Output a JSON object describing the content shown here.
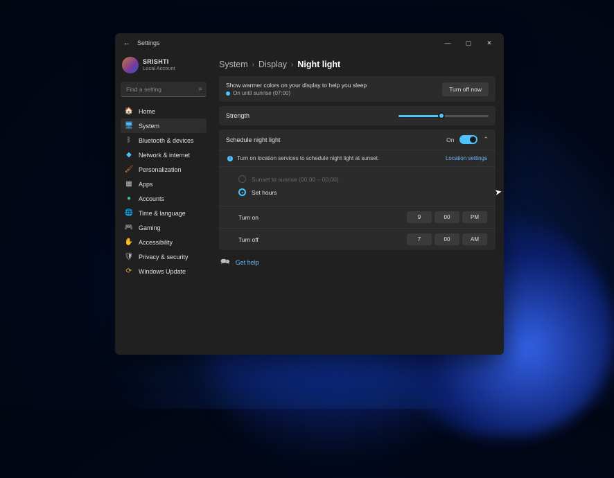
{
  "window": {
    "title": "Settings"
  },
  "user": {
    "name": "SRISHTI",
    "sub": "Local Account"
  },
  "search": {
    "placeholder": "Find a setting"
  },
  "nav": {
    "items": [
      {
        "icon": "🏠",
        "label": "Home",
        "cls": "i-gray"
      },
      {
        "icon": "🖥",
        "label": "System",
        "cls": "i-blue",
        "active": true
      },
      {
        "icon": "ᛒ",
        "label": "Bluetooth & devices",
        "cls": "i-gray"
      },
      {
        "icon": "◆",
        "label": "Network & internet",
        "cls": "i-blue"
      },
      {
        "icon": "🖌",
        "label": "Personalization",
        "cls": "i-orange"
      },
      {
        "icon": "▦",
        "label": "Apps",
        "cls": "i-gray"
      },
      {
        "icon": "●",
        "label": "Accounts",
        "cls": "i-teal"
      },
      {
        "icon": "🌐",
        "label": "Time & language",
        "cls": "i-gray"
      },
      {
        "icon": "🎮",
        "label": "Gaming",
        "cls": "i-gray"
      },
      {
        "icon": "✋",
        "label": "Accessibility",
        "cls": "i-blue"
      },
      {
        "icon": "🛡",
        "label": "Privacy & security",
        "cls": "i-gray"
      },
      {
        "icon": "⟳",
        "label": "Windows Update",
        "cls": "i-yellow"
      }
    ]
  },
  "breadcrumb": {
    "a": "System",
    "b": "Display",
    "c": "Night light"
  },
  "top": {
    "line1": "Show warmer colors on your display to help you sleep",
    "line2": "On until sunrise (07:00)",
    "button": "Turn off now"
  },
  "strength": {
    "label": "Strength",
    "percent": 48
  },
  "schedule": {
    "label": "Schedule night light",
    "state": "On",
    "info": "Turn on location services to schedule night light at sunset.",
    "link": "Location settings",
    "opt_sunset": "Sunset to sunrise (00:00 – 00:00)",
    "opt_hours": "Set hours",
    "turn_on": {
      "label": "Turn on",
      "h": "9",
      "m": "00",
      "ap": "PM"
    },
    "turn_off": {
      "label": "Turn off",
      "h": "7",
      "m": "00",
      "ap": "AM"
    }
  },
  "help": {
    "label": "Get help"
  }
}
